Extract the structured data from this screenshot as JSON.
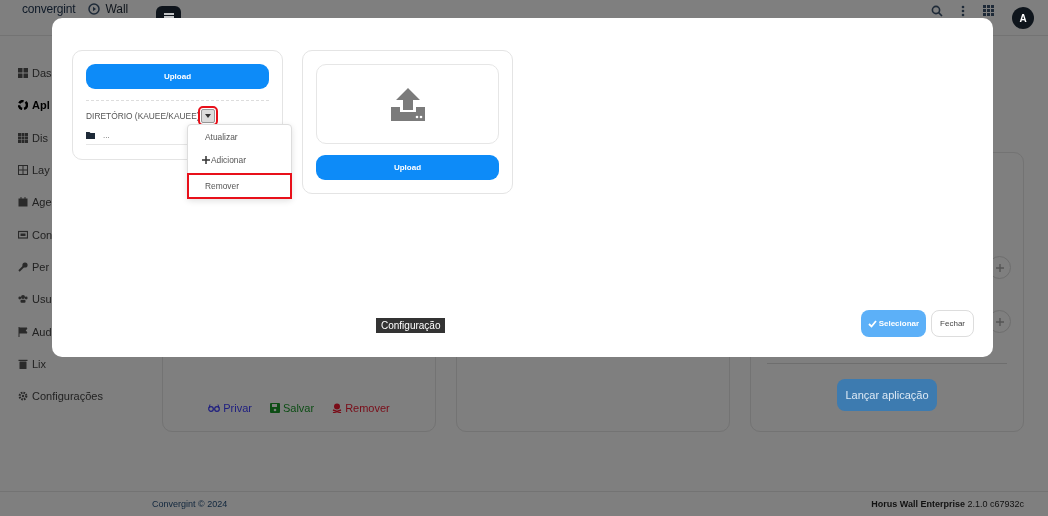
{
  "header": {
    "logo": "convergint",
    "app_name": "Wall",
    "avatar": "A"
  },
  "sidebar": {
    "items": [
      {
        "label": "Das",
        "kind": "dashboard",
        "selected": false
      },
      {
        "label": "Apl",
        "kind": "apps",
        "selected": true
      },
      {
        "label": "Dis",
        "kind": "devices",
        "selected": false
      },
      {
        "label": "Lay",
        "kind": "layout",
        "selected": false
      },
      {
        "label": "Age",
        "kind": "calendar",
        "selected": false
      },
      {
        "label": "Con",
        "kind": "content",
        "selected": false
      },
      {
        "label": "Per",
        "kind": "key",
        "selected": false
      },
      {
        "label": "Usu",
        "kind": "users",
        "selected": false
      },
      {
        "label": "Aud",
        "kind": "flag",
        "selected": false
      },
      {
        "label": "Lix",
        "kind": "trash",
        "selected": false
      },
      {
        "label": "Configurações",
        "kind": "gear",
        "selected": false
      }
    ]
  },
  "card_actions": [
    {
      "label": "Privar",
      "kind": "privar"
    },
    {
      "label": "Salvar",
      "kind": "salvar"
    },
    {
      "label": "Remover",
      "kind": "remover"
    }
  ],
  "launch_button": "Lançar aplicação",
  "footer": {
    "copyright": "Convergint © 2024",
    "product": "Horus Wall Enterprise",
    "version": "2.1.0 c67932c"
  },
  "modal": {
    "directory_panel": {
      "upload_button": "Upload",
      "directory_label": "DIRETÓRIO (KAUEE/KAUEE)",
      "toggle_highlighted": true,
      "entries": [
        {
          "name": "..."
        }
      ]
    },
    "menu": {
      "items": [
        {
          "label": "Atualizar",
          "kind": "plain",
          "highlighted": false
        },
        {
          "label": "Adicionar",
          "kind": "add",
          "highlighted": false
        },
        {
          "label": "Remover",
          "kind": "plain",
          "highlighted": true
        }
      ]
    },
    "upload_panel": {
      "upload_button": "Upload"
    },
    "tooltip": "Configuração",
    "buttons": [
      {
        "label": "Selecionar",
        "kind": "primary"
      },
      {
        "label": "Fechar",
        "kind": "secondary"
      }
    ]
  }
}
